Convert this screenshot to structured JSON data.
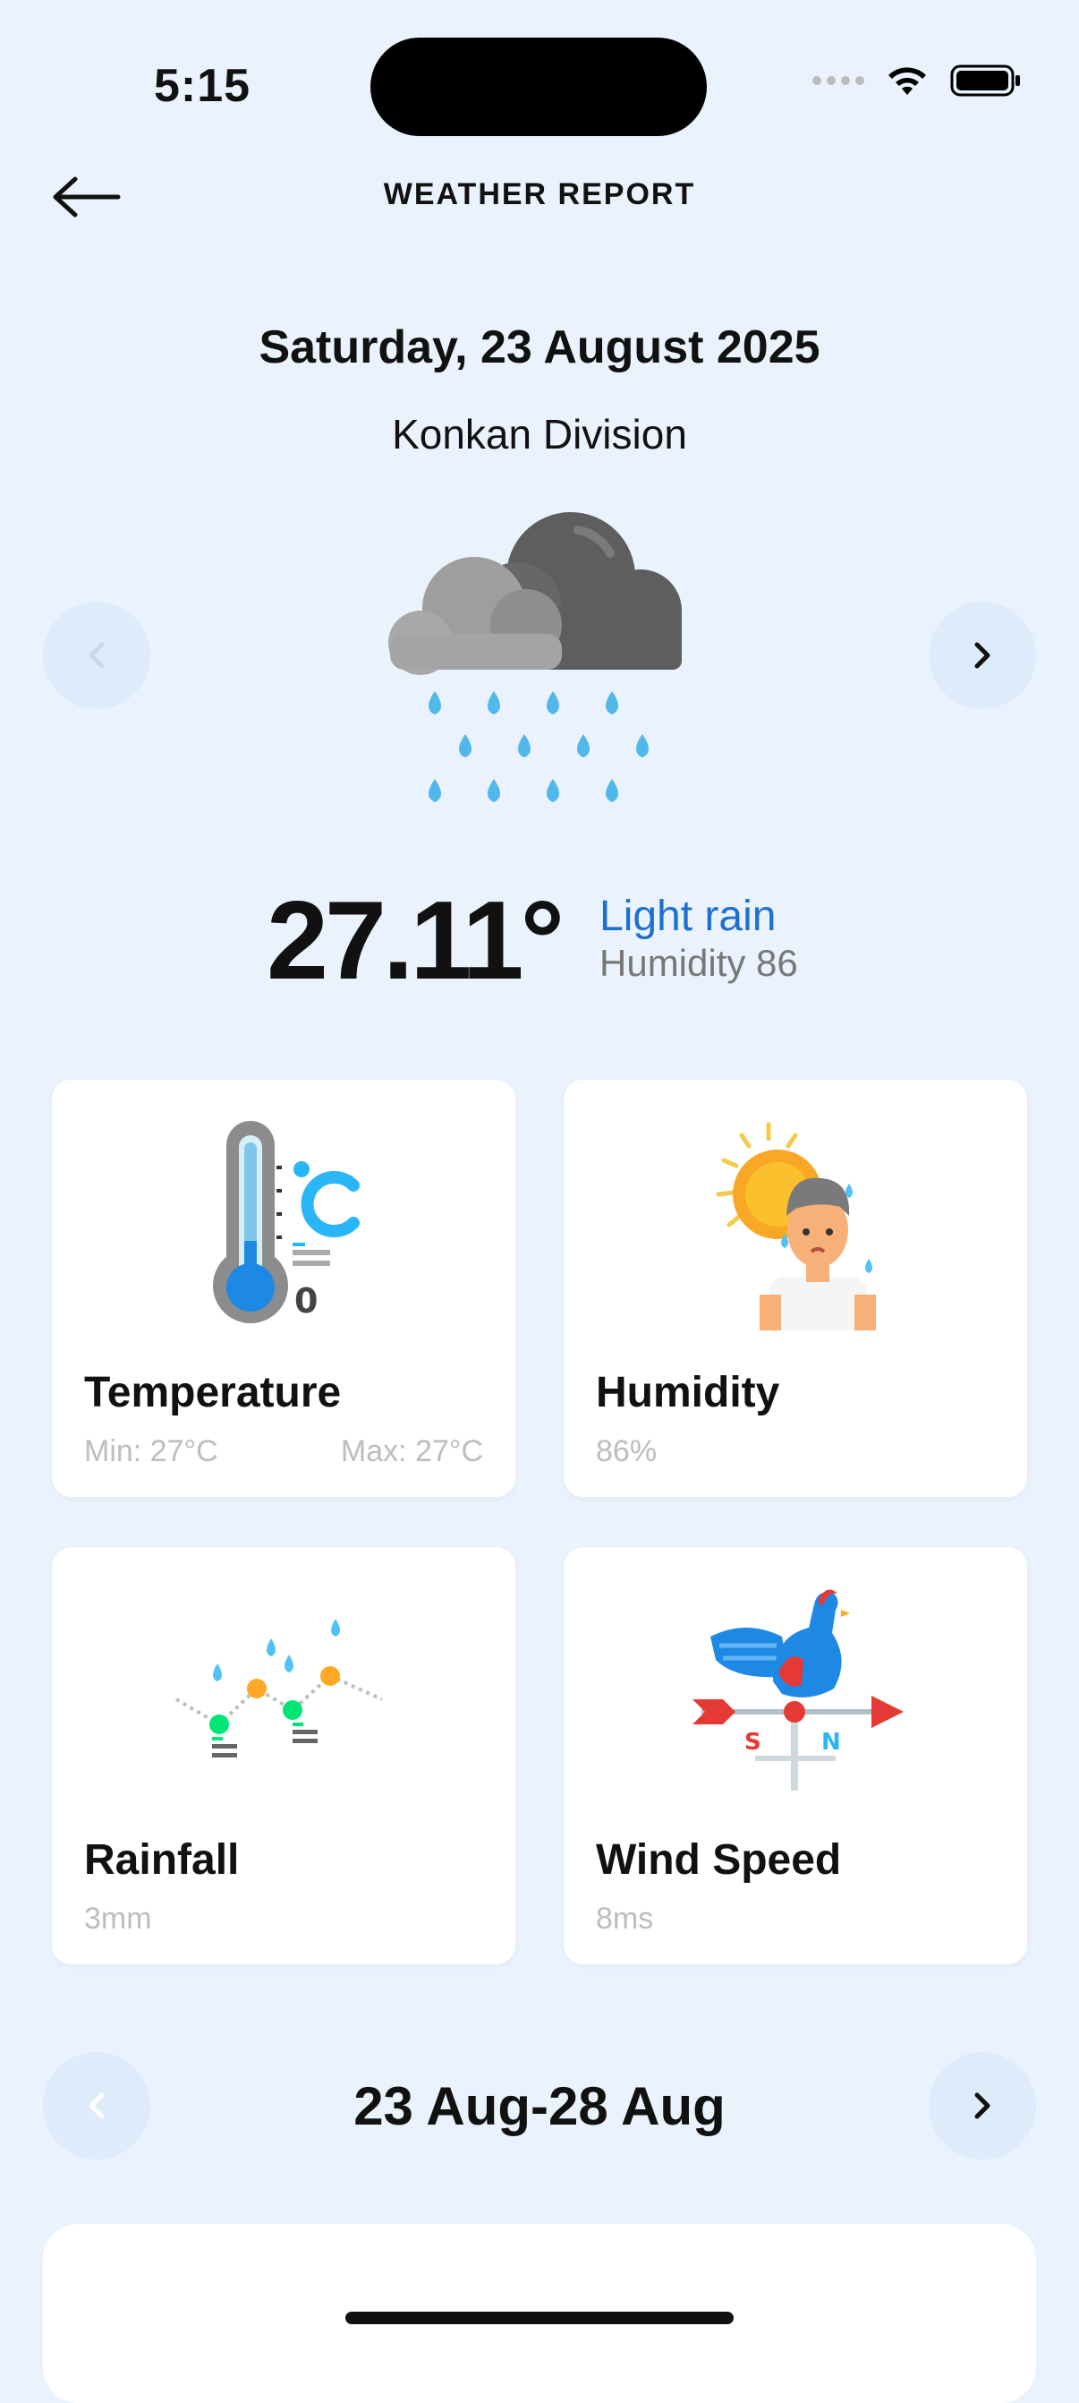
{
  "status": {
    "time": "5:15"
  },
  "header": {
    "title": "WEATHER REPORT"
  },
  "current": {
    "date": "Saturday, 23 August 2025",
    "region": "Konkan Division",
    "temperature": "27.11°",
    "condition": "Light rain",
    "humidity": "Humidity 86"
  },
  "cards": {
    "temperature": {
      "title": "Temperature",
      "min": "Min: 27°C",
      "max": "Max: 27°C"
    },
    "humidity": {
      "title": "Humidity",
      "value": "86%"
    },
    "rainfall": {
      "title": "Rainfall",
      "value": "3mm"
    },
    "wind": {
      "title": "Wind Speed",
      "value": "8ms"
    }
  },
  "forecast": {
    "range": "23 Aug-28 Aug"
  },
  "colors": {
    "background": "#EAF3FD",
    "accent": "#1E6FD0",
    "card": "#FFFFFF"
  }
}
